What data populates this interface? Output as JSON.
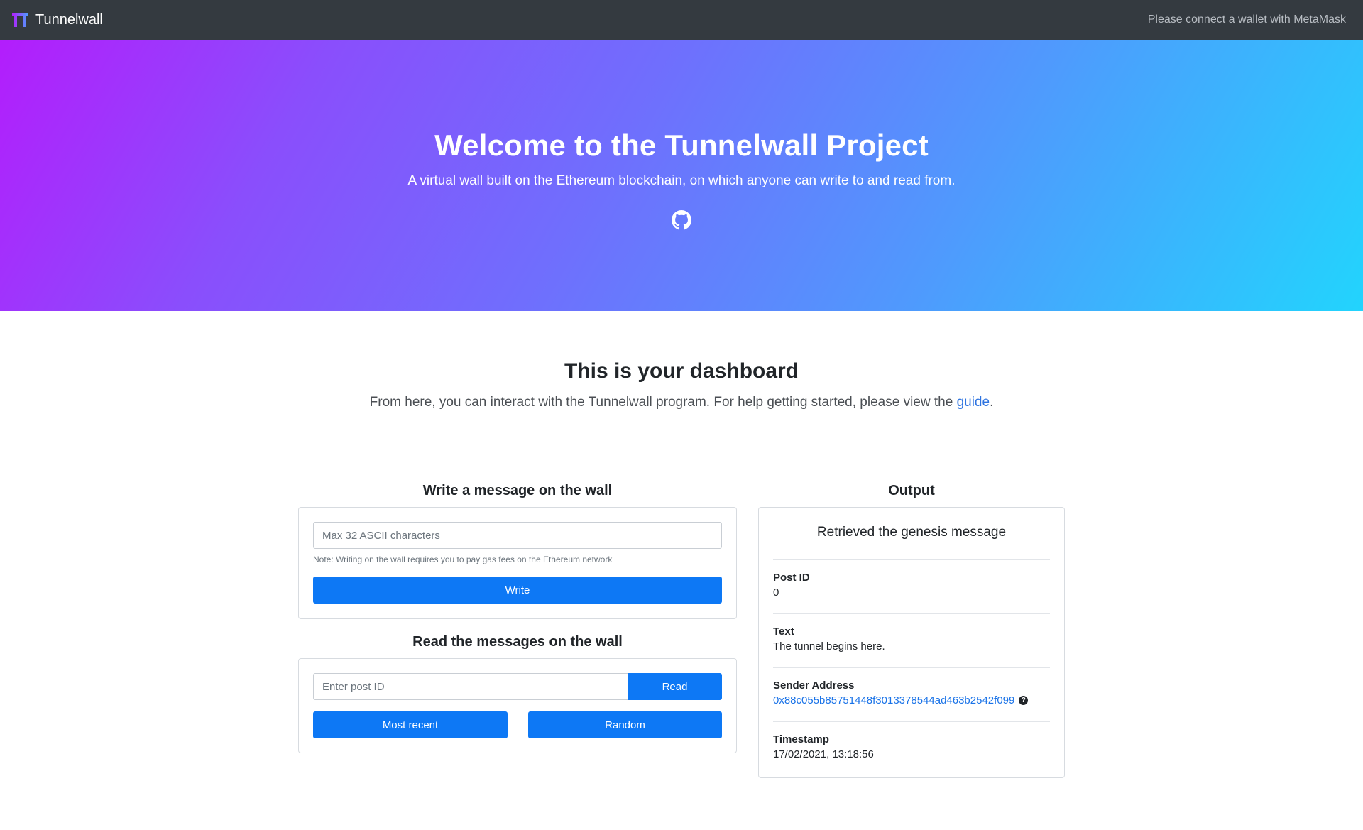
{
  "navbar": {
    "brand": "Tunnelwall",
    "wallet_status": "Please connect a wallet with MetaMask"
  },
  "hero": {
    "title": "Welcome to the Tunnelwall Project",
    "subtitle": "A virtual wall built on the Ethereum blockchain, on which anyone can write to and read from.",
    "icon": "github-icon"
  },
  "dashboard": {
    "title": "This is your dashboard",
    "subtitle_prefix": "From here, you can interact with the Tunnelwall program. For help getting started, please view the ",
    "guide_link": "guide",
    "subtitle_suffix": "."
  },
  "write_section": {
    "heading": "Write a message on the wall",
    "input_placeholder": "Max 32 ASCII characters",
    "note": "Note: Writing on the wall requires you to pay gas fees on the Ethereum network",
    "write_button": "Write"
  },
  "read_section": {
    "heading": "Read the messages on the wall",
    "input_placeholder": "Enter post ID",
    "read_button": "Read",
    "most_recent_button": "Most recent",
    "random_button": "Random"
  },
  "output": {
    "heading": "Output",
    "title": "Retrieved the genesis message",
    "post_id_label": "Post ID",
    "post_id_value": "0",
    "text_label": "Text",
    "text_value": "The tunnel begins here.",
    "sender_label": "Sender Address",
    "sender_value": "0x88c055b85751448f3013378544ad463b2542f099",
    "help_glyph": "?",
    "timestamp_label": "Timestamp",
    "timestamp_value": "17/02/2021, 13:18:56"
  },
  "colors": {
    "navbar_bg": "#343a40",
    "primary_button": "#0d78f5",
    "link": "#1a73e8",
    "hero_gradient_start": "#b31dfc",
    "hero_gradient_end": "#22d4fd"
  }
}
